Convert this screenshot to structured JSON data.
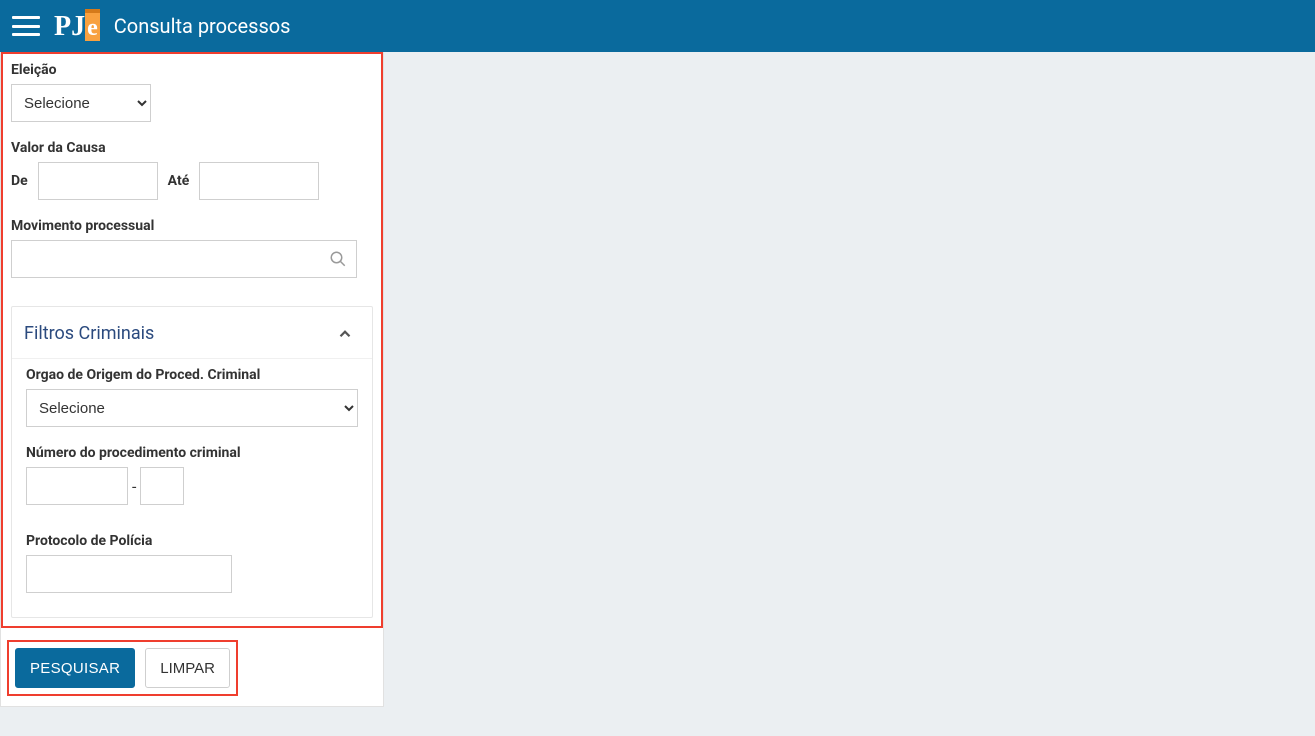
{
  "header": {
    "title": "Consulta processos",
    "logo": {
      "p": "P",
      "j": "J",
      "e": "e"
    }
  },
  "form": {
    "eleicao": {
      "label": "Eleição",
      "options": [
        "Selecione"
      ],
      "value": "Selecione"
    },
    "valor_causa": {
      "label": "Valor da Causa",
      "de_label": "De",
      "ate_label": "Até",
      "de": "",
      "ate": ""
    },
    "movimento": {
      "label": "Movimento processual",
      "value": ""
    },
    "criminais": {
      "title": "Filtros Criminais",
      "orgao": {
        "label": "Orgao de Origem do Proced. Criminal",
        "options": [
          "Selecione"
        ],
        "value": "Selecione"
      },
      "numero": {
        "label": "Número do procedimento criminal",
        "a": "",
        "b": ""
      },
      "protocolo": {
        "label": "Protocolo de Polícia",
        "value": ""
      }
    }
  },
  "buttons": {
    "pesquisar": "PESQUISAR",
    "limpar": "LIMPAR"
  }
}
